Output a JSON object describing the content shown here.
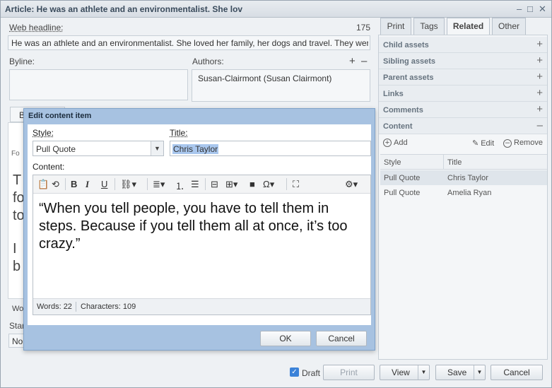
{
  "window": {
    "title": "Article: He was an athlete and an environmentalist. She lov",
    "controls": [
      "–",
      "□",
      "✕"
    ]
  },
  "form": {
    "web_headline_label": "Web headline:",
    "web_headline_count": "175",
    "web_headline_value": "He was an athlete and an environmentalist. She loved her family, her dogs and travel. They were",
    "byline_label": "Byline:",
    "authors_label": "Authors:",
    "authors_add": "+",
    "authors_remove": "–",
    "author_entry": "Susan-Clairmont (Susan Clairmont)",
    "hidden_tab_letter": "B",
    "hidden_fo": "Fo",
    "hidden_body_lines": [
      "T",
      "fo",
      "to",
      "I",
      "b"
    ],
    "hidden_words": "Wo",
    "start_label": "Star",
    "start_value": "No"
  },
  "side_tabs": [
    "Print",
    "Tags",
    "Related",
    "Other"
  ],
  "related_sections": [
    {
      "name": "Child assets",
      "toggle": "+"
    },
    {
      "name": "Sibling assets",
      "toggle": "+"
    },
    {
      "name": "Parent assets",
      "toggle": "+"
    },
    {
      "name": "Links",
      "toggle": "+"
    },
    {
      "name": "Comments",
      "toggle": "+"
    },
    {
      "name": "Content",
      "toggle": "–"
    }
  ],
  "content_panel": {
    "add_label": "Add",
    "edit_label": "Edit",
    "remove_label": "Remove",
    "columns": [
      "Style",
      "Title"
    ],
    "rows": [
      {
        "style": "Pull Quote",
        "title": "Chris Taylor"
      },
      {
        "style": "Pull Quote",
        "title": "Amelia Ryan"
      }
    ]
  },
  "modal": {
    "title": "Edit content item",
    "style_label": "Style:",
    "style_value": "Pull Quote",
    "title_label": "Title:",
    "title_value": "Chris Taylor",
    "content_label": "Content:",
    "content_text": "“When you tell people, you have to tell them in steps. Because if you tell them all at once, it’s too crazy.”",
    "words": "Words: 22",
    "characters": "Characters: 109",
    "ok_label": "OK",
    "cancel_label": "Cancel"
  },
  "footer": {
    "draft_label": "Draft",
    "draft_checked": true,
    "print_label": "Print",
    "view_label": "View",
    "save_label": "Save",
    "cancel_label": "Cancel"
  }
}
